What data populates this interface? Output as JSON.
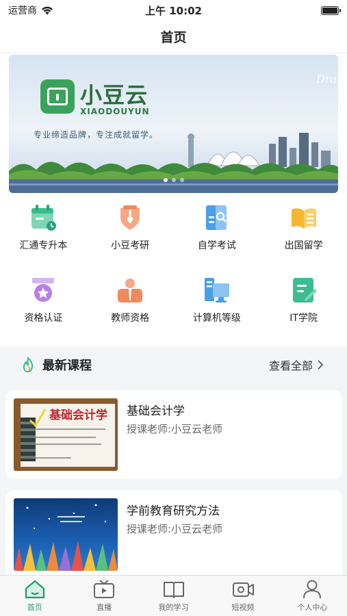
{
  "status_bar": {
    "carrier": "运营商",
    "time": "上午 10:02"
  },
  "nav": {
    "title": "首页"
  },
  "banner": {
    "brand": "小豆云",
    "brand_en": "XIAODOUYUN",
    "slogan": "专业缔造品牌，专注成就留学。",
    "corner_text": "Dra",
    "active_dot": 0,
    "dot_count": 3
  },
  "categories": [
    {
      "label": "汇通专升本",
      "icon": "calendar-icon",
      "color": "#3cbc8f"
    },
    {
      "label": "小豆考研",
      "icon": "pen-nib-icon",
      "color": "#f08a5d"
    },
    {
      "label": "自学考试",
      "icon": "book-search-icon",
      "color": "#4a9fe8"
    },
    {
      "label": "出国留学",
      "icon": "open-book-icon",
      "color": "#f5b731"
    },
    {
      "label": "资格认证",
      "icon": "medal-icon",
      "color": "#b582e6"
    },
    {
      "label": "教师资格",
      "icon": "teacher-icon",
      "color": "#f08a5d"
    },
    {
      "label": "计算机等级",
      "icon": "computer-icon",
      "color": "#4a9fe8"
    },
    {
      "label": "IT学院",
      "icon": "note-edit-icon",
      "color": "#3cbc8f"
    }
  ],
  "section": {
    "title": "最新课程",
    "more": "查看全部"
  },
  "courses": [
    {
      "name": "基础会计学",
      "teacher": "授课老师:小豆云老师",
      "thumb_title": "基础会计学"
    },
    {
      "name": "学前教育研究方法",
      "teacher": "授课老师:小豆云老师"
    }
  ],
  "tabbar": [
    {
      "label": "首页",
      "icon": "home-icon",
      "active": true
    },
    {
      "label": "直播",
      "icon": "tv-icon",
      "active": false
    },
    {
      "label": "我的学习",
      "icon": "book-icon",
      "active": false
    },
    {
      "label": "短视频",
      "icon": "video-camera-icon",
      "active": false
    },
    {
      "label": "个人中心",
      "icon": "user-icon",
      "active": false
    }
  ],
  "colors": {
    "accent": "#1d9c6b",
    "brand_green": "#2c6e3c"
  }
}
